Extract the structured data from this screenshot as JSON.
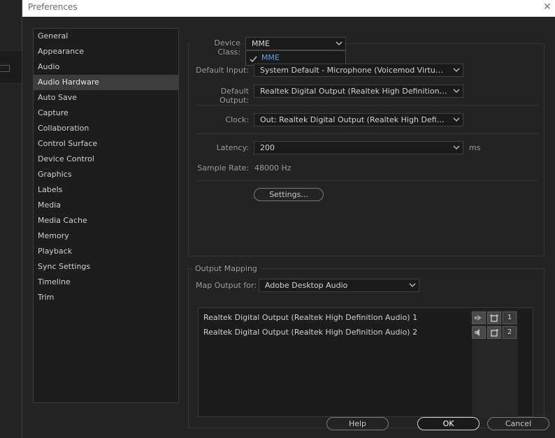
{
  "window": {
    "title": "Preferences"
  },
  "sidebar": {
    "items": [
      {
        "label": "General"
      },
      {
        "label": "Appearance"
      },
      {
        "label": "Audio"
      },
      {
        "label": "Audio Hardware",
        "active": true
      },
      {
        "label": "Auto Save"
      },
      {
        "label": "Capture"
      },
      {
        "label": "Collaboration"
      },
      {
        "label": "Control Surface"
      },
      {
        "label": "Device Control"
      },
      {
        "label": "Graphics"
      },
      {
        "label": "Labels"
      },
      {
        "label": "Media"
      },
      {
        "label": "Media Cache"
      },
      {
        "label": "Memory"
      },
      {
        "label": "Playback"
      },
      {
        "label": "Sync Settings"
      },
      {
        "label": "Timeline"
      },
      {
        "label": "Trim"
      }
    ]
  },
  "device": {
    "class_label": "Device Class:",
    "class_value": "MME",
    "class_options": [
      {
        "label": "MME",
        "checked": true
      }
    ],
    "input_label": "Default Input:",
    "input_value": "System Default - Microphone (Voicemod Virtual Audi...",
    "output_label": "Default Output:",
    "output_value": "Realtek Digital Output (Realtek High Definition Audio...",
    "clock_label": "Clock:",
    "clock_value": "Out: Realtek Digital Output (Realtek High Definition ...",
    "latency_label": "Latency:",
    "latency_value": "200",
    "latency_units": "ms",
    "sample_rate_label": "Sample Rate:",
    "sample_rate_value": "48000 Hz",
    "settings_button": "Settings..."
  },
  "output_mapping": {
    "section_label": "Output Mapping",
    "map_for_label": "Map Output for:",
    "map_for_value": "Adobe Desktop Audio",
    "rows": [
      {
        "label": "Realtek Digital Output (Realtek High Definition Audio) 1",
        "channel": "1"
      },
      {
        "label": "Realtek Digital Output (Realtek High Definition Audio) 2",
        "channel": "2"
      }
    ]
  },
  "footer": {
    "help": "Help",
    "ok": "OK",
    "cancel": "Cancel"
  }
}
